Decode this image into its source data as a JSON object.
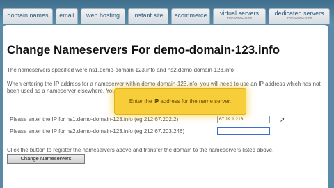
{
  "tabs": [
    {
      "label": "domain names"
    },
    {
      "label": "email"
    },
    {
      "label": "web hosting"
    },
    {
      "label": "instant site"
    },
    {
      "label": "ecommerce"
    },
    {
      "label": "virtual servers",
      "sub": "from WebFusion"
    },
    {
      "label": "dedicated servers",
      "sub": "from WebFusion"
    }
  ],
  "page": {
    "title": "Change Nameservers For demo-domain-123.info",
    "specified_text": "The nameservers specified were ns1.demo-domain-123.info and ns2.demo-domain-123.info",
    "instructions": "When entering the IP address for a nameserver within demo-domain-123.info, you will need to use an IP address which has not been used as a nameserver elsewhere. You cannot use the same IP for different nameservers.",
    "ns1_label": "Please enter the IP for ns1.demo-domain-123.info (eg 212.67.202.2)",
    "ns1_value": "67.19.1.218",
    "ns2_label": "Please enter the IP for ns2.demo-domain-123.info (eg 212.67.203.246)",
    "ns2_value": "",
    "footer_text": "Click the button to register the nameservers above and transfer the domain to the nameservers listed above.",
    "button_label": "Change Nameservers"
  },
  "tooltip": {
    "before": "Enter the ",
    "bold": "IP",
    "after": " address for the name server."
  }
}
